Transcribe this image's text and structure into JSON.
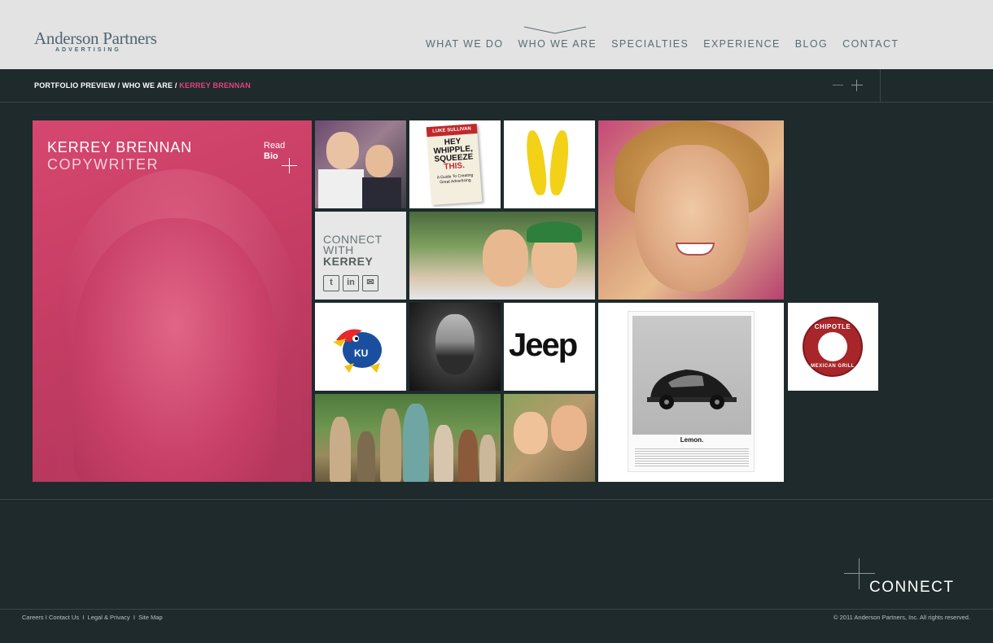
{
  "brand": {
    "name": "Anderson Partners",
    "sub": "ADVERTISING"
  },
  "nav": {
    "items": [
      {
        "label": "WHAT WE DO"
      },
      {
        "label": "WHO WE ARE",
        "active": true
      },
      {
        "label": "SPECIALTIES"
      },
      {
        "label": "EXPERIENCE"
      },
      {
        "label": "BLOG"
      },
      {
        "label": "CONTACT"
      }
    ]
  },
  "breadcrumb": {
    "items": [
      "PORTFOLIO PREVIEW",
      "WHO WE ARE",
      "KERREY BRENNAN"
    ],
    "separator": "/",
    "current_color": "#e0457a"
  },
  "profile": {
    "name": "KERREY BRENNAN",
    "title": "COPYWRITER",
    "read_label": "Read",
    "bio_label": "Bio",
    "accent_color": "#d1436c"
  },
  "connect_tile": {
    "line1": "CONNECT",
    "line2": "WITH",
    "line3": "KERREY",
    "social": [
      {
        "icon": "twitter-icon",
        "glyph": "t"
      },
      {
        "icon": "linkedin-icon",
        "glyph": "in"
      },
      {
        "icon": "email-icon",
        "glyph": "✉"
      }
    ]
  },
  "gallery": {
    "book": {
      "author": "LUKE SULLIVAN",
      "title_lines": [
        "HEY",
        "WHIPPLE,",
        "SQUEEZE",
        "THIS."
      ],
      "subtitle": "A Guide To Creating Great Advertising"
    },
    "jeep": "Jeep",
    "ku": "KU",
    "vw_caption": "Lemon.",
    "chipotle_top": "CHIPOTLE",
    "chipotle_bottom": "MEXICAN GRILL"
  },
  "footer": {
    "connect": "CONNECT",
    "links": [
      "Careers",
      "Contact Us",
      "Legal & Privacy",
      "Site Map"
    ],
    "copyright": "© 2011 Anderson Partners, Inc. All rights reserved."
  },
  "colors": {
    "background": "#1e2a2b",
    "header": "#e3e3e3",
    "nav_text": "#5a6c72"
  }
}
